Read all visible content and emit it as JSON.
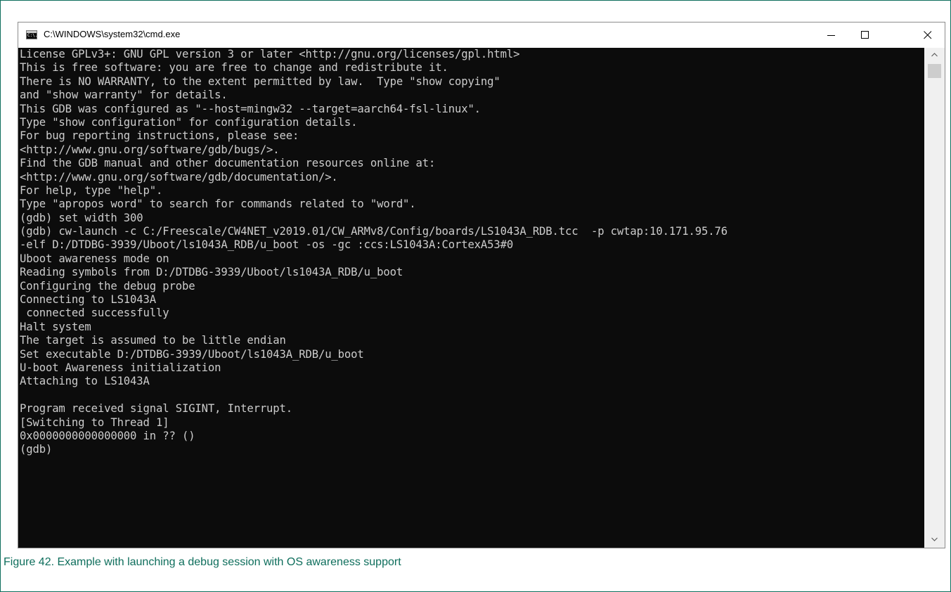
{
  "window": {
    "title": "C:\\WINDOWS\\system32\\cmd.exe",
    "icon_text": "C:\\."
  },
  "controls": {
    "minimize_icon": "minimize-icon",
    "maximize_icon": "maximize-icon",
    "close_icon": "close-icon"
  },
  "console": {
    "lines": [
      "License GPLv3+: GNU GPL version 3 or later <http://gnu.org/licenses/gpl.html>",
      "This is free software: you are free to change and redistribute it.",
      "There is NO WARRANTY, to the extent permitted by law.  Type \"show copying\"",
      "and \"show warranty\" for details.",
      "This GDB was configured as \"--host=mingw32 --target=aarch64-fsl-linux\".",
      "Type \"show configuration\" for configuration details.",
      "For bug reporting instructions, please see:",
      "<http://www.gnu.org/software/gdb/bugs/>.",
      "Find the GDB manual and other documentation resources online at:",
      "<http://www.gnu.org/software/gdb/documentation/>.",
      "For help, type \"help\".",
      "Type \"apropos word\" to search for commands related to \"word\".",
      "(gdb) set width 300",
      "(gdb) cw-launch -c C:/Freescale/CW4NET_v2019.01/CW_ARMv8/Config/boards/LS1043A_RDB.tcc  -p cwtap:10.171.95.76",
      "-elf D:/DTDBG-3939/Uboot/ls1043A_RDB/u_boot -os -gc :ccs:LS1043A:CortexA53#0",
      "Uboot awareness mode on",
      "Reading symbols from D:/DTDBG-3939/Uboot/ls1043A_RDB/u_boot",
      "Configuring the debug probe",
      "Connecting to LS1043A",
      " connected successfully",
      "Halt system",
      "The target is assumed to be little endian",
      "Set executable D:/DTDBG-3939/Uboot/ls1043A_RDB/u_boot",
      "U-boot Awareness initialization",
      "Attaching to LS1043A",
      "",
      "Program received signal SIGINT, Interrupt.",
      "[Switching to Thread 1]",
      "0x0000000000000000 in ?? ()",
      "(gdb)"
    ]
  },
  "caption": "Figure 42. Example with launching a debug session with OS awareness support",
  "colors": {
    "console_bg": "#0c0c0c",
    "console_fg": "#cccccc",
    "caption": "#0e6e5c"
  }
}
